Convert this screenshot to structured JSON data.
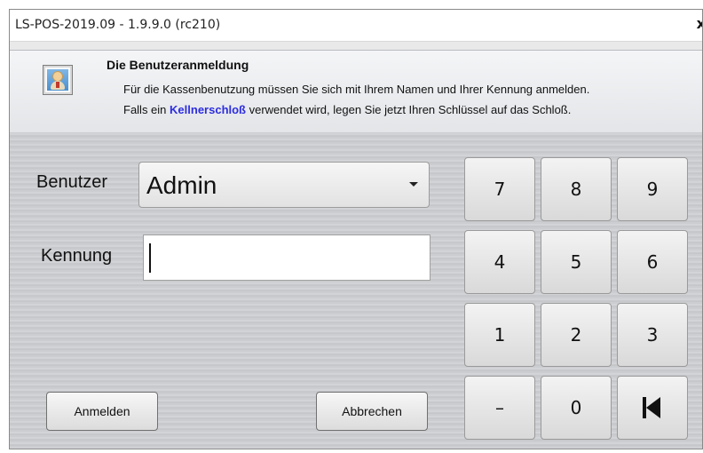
{
  "window": {
    "title": "LS-POS-2019.09 - 1.9.9.0 (rc210)",
    "close_label": "x"
  },
  "header": {
    "title": "Die Benutzeranmeldung",
    "line1": "Für die Kassenbenutzung müssen Sie sich mit Ihrem Namen und Ihrer Kennung anmelden.",
    "line2_before": "Falls ein ",
    "line2_link": "Kellnerschloß",
    "line2_after": " verwendet wird, legen Sie jetzt Ihren Schlüssel auf das Schloß.",
    "icon": "user-login-icon"
  },
  "form": {
    "user_label": "Benutzer",
    "user_value": "Admin",
    "password_label": "Kennung",
    "password_value": ""
  },
  "buttons": {
    "login": "Anmelden",
    "cancel": "Abbrechen"
  },
  "keypad": {
    "k7": "7",
    "k8": "8",
    "k9": "9",
    "k4": "4",
    "k5": "5",
    "k6": "6",
    "k1": "1",
    "k2": "2",
    "k3": "3",
    "minus": "–",
    "k0": "0",
    "backspace_icon": "backspace-icon"
  },
  "colors": {
    "accent_link": "#2d2de0",
    "background": "#cfd0d3"
  }
}
